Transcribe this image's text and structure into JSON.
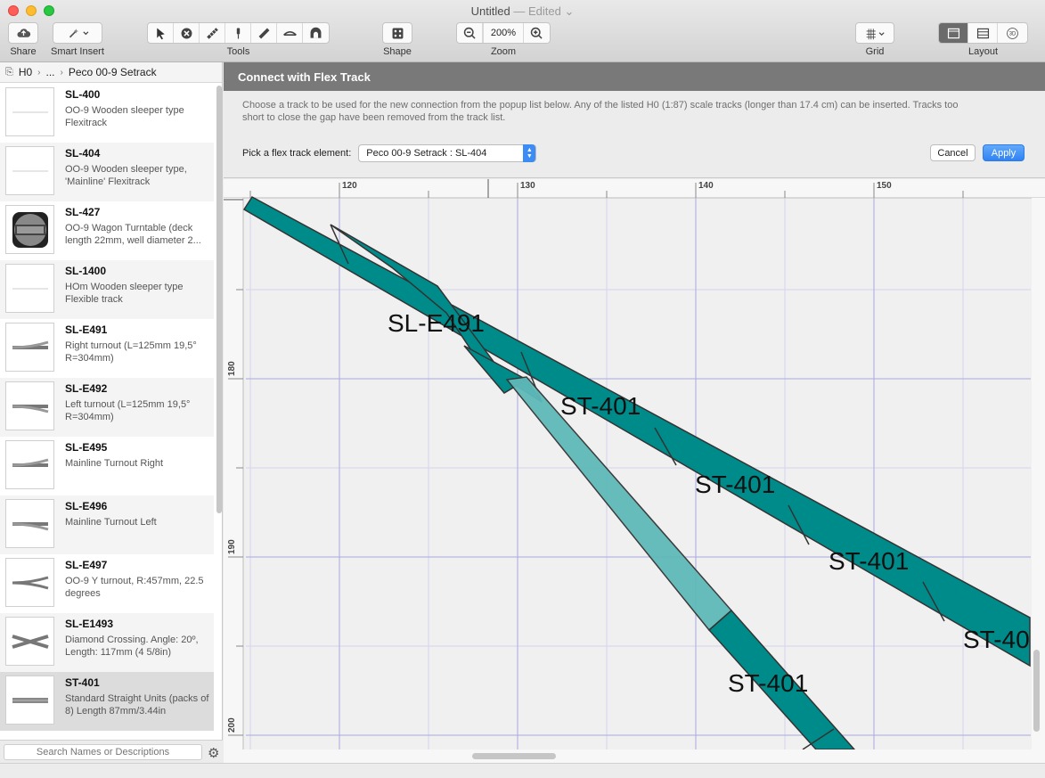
{
  "window": {
    "title": "Untitled",
    "edited": "— Edited",
    "edited_chevron": "⌄"
  },
  "toolbar": {
    "share_label": "Share",
    "smart_insert_label": "Smart Insert",
    "tools_label": "Tools",
    "shape_label": "Shape",
    "zoom_label": "Zoom",
    "zoom_value": "200%",
    "grid_label": "Grid",
    "layout_label": "Layout",
    "layout_3d": "3D"
  },
  "breadcrumb": {
    "root": "H0",
    "middle": "...",
    "current": "Peco 00-9 Setrack"
  },
  "items": [
    {
      "name": "SL-400",
      "desc": "OO-9 Wooden sleeper type Flexitrack",
      "thumb": "flex-track-icon"
    },
    {
      "name": "SL-404",
      "desc": "OO-9 Wooden sleeper type, 'Mainline' Flexitrack",
      "thumb": "flex-track-icon"
    },
    {
      "name": "SL-427",
      "desc": "OO-9 Wagon Turntable (deck length 22mm, well diameter 2...",
      "thumb": "turntable-icon"
    },
    {
      "name": "SL-1400",
      "desc": "HOm Wooden sleeper type Flexible track",
      "thumb": "flex-track-icon"
    },
    {
      "name": "SL-E491",
      "desc": "Right turnout (L=125mm 19,5° R=304mm)",
      "thumb": "turnout-right-icon"
    },
    {
      "name": "SL-E492",
      "desc": "Left turnout (L=125mm 19,5° R=304mm)",
      "thumb": "turnout-left-icon"
    },
    {
      "name": "SL-E495",
      "desc": "Mainline Turnout Right",
      "thumb": "turnout-right-icon"
    },
    {
      "name": "SL-E496",
      "desc": "Mainline Turnout Left",
      "thumb": "turnout-left-icon"
    },
    {
      "name": "SL-E497",
      "desc": "OO-9 Y turnout, R:457mm, 22.5 degrees",
      "thumb": "y-turnout-icon"
    },
    {
      "name": "SL-E1493",
      "desc": "Diamond Crossing. Angle: 20º, Length: 117mm (4 5/8in)",
      "thumb": "diamond-crossing-icon"
    },
    {
      "name": "ST-401",
      "desc": "Standard Straight Units (packs of 8) Length 87mm/3.44in",
      "thumb": "straight-track-icon"
    }
  ],
  "search": {
    "placeholder": "Search Names or Descriptions"
  },
  "panel": {
    "title": "Connect with Flex Track",
    "description": "Choose a track to be used for the new connection from the popup list below. Any of the listed H0  (1:87) scale tracks (longer than 17.4 cm) can be inserted. Tracks too short to close the gap have been removed from the track list.",
    "pick_label": "Pick a flex track element:",
    "selected_option": "Peco 00-9 Setrack  :  SL-404",
    "cancel_label": "Cancel",
    "apply_label": "Apply"
  },
  "ruler": {
    "x_ticks": [
      "120",
      "130",
      "140",
      "150"
    ],
    "y_ticks": [
      "180",
      "190",
      "200"
    ]
  },
  "canvas_labels": {
    "turnout": "SL-E491",
    "straight": "ST-401",
    "straight_clipped": "ST-40"
  },
  "colors": {
    "track": "#008b8b",
    "flex_preview": "#5fb9b9",
    "accent": "#3b8cf4"
  }
}
